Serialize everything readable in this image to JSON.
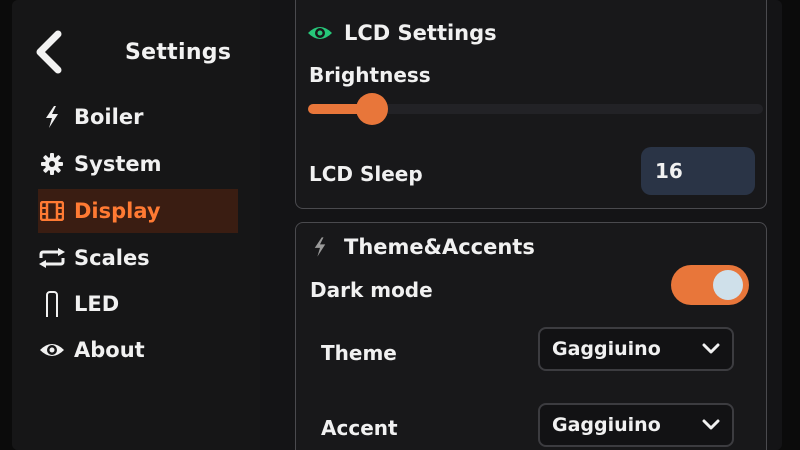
{
  "sidebar": {
    "title": "Settings",
    "items": [
      {
        "label": "Boiler",
        "icon": "bolt-icon"
      },
      {
        "label": "System",
        "icon": "gear-icon"
      },
      {
        "label": "Display",
        "icon": "film-icon"
      },
      {
        "label": "Scales",
        "icon": "repeat-icon"
      },
      {
        "label": "LED",
        "icon": "led-icon"
      },
      {
        "label": "About",
        "icon": "eye-icon"
      }
    ],
    "active": "Display"
  },
  "lcd": {
    "title": "LCD Settings",
    "brightness_label": "Brightness",
    "brightness_value": 0.15,
    "sleep_label": "LCD Sleep",
    "sleep_value": "16"
  },
  "theme": {
    "title": "Theme&Accents",
    "dark_mode_label": "Dark mode",
    "dark_mode_on": true,
    "theme_label": "Theme",
    "theme_value": "Gaggiuino",
    "accent_label": "Accent",
    "accent_value": "Gaggiuino"
  },
  "colors": {
    "accent": "#e8763a",
    "eye_icon": "#27c77a",
    "active_bg": "#3a1d12",
    "input_bg": "#2a3446"
  }
}
